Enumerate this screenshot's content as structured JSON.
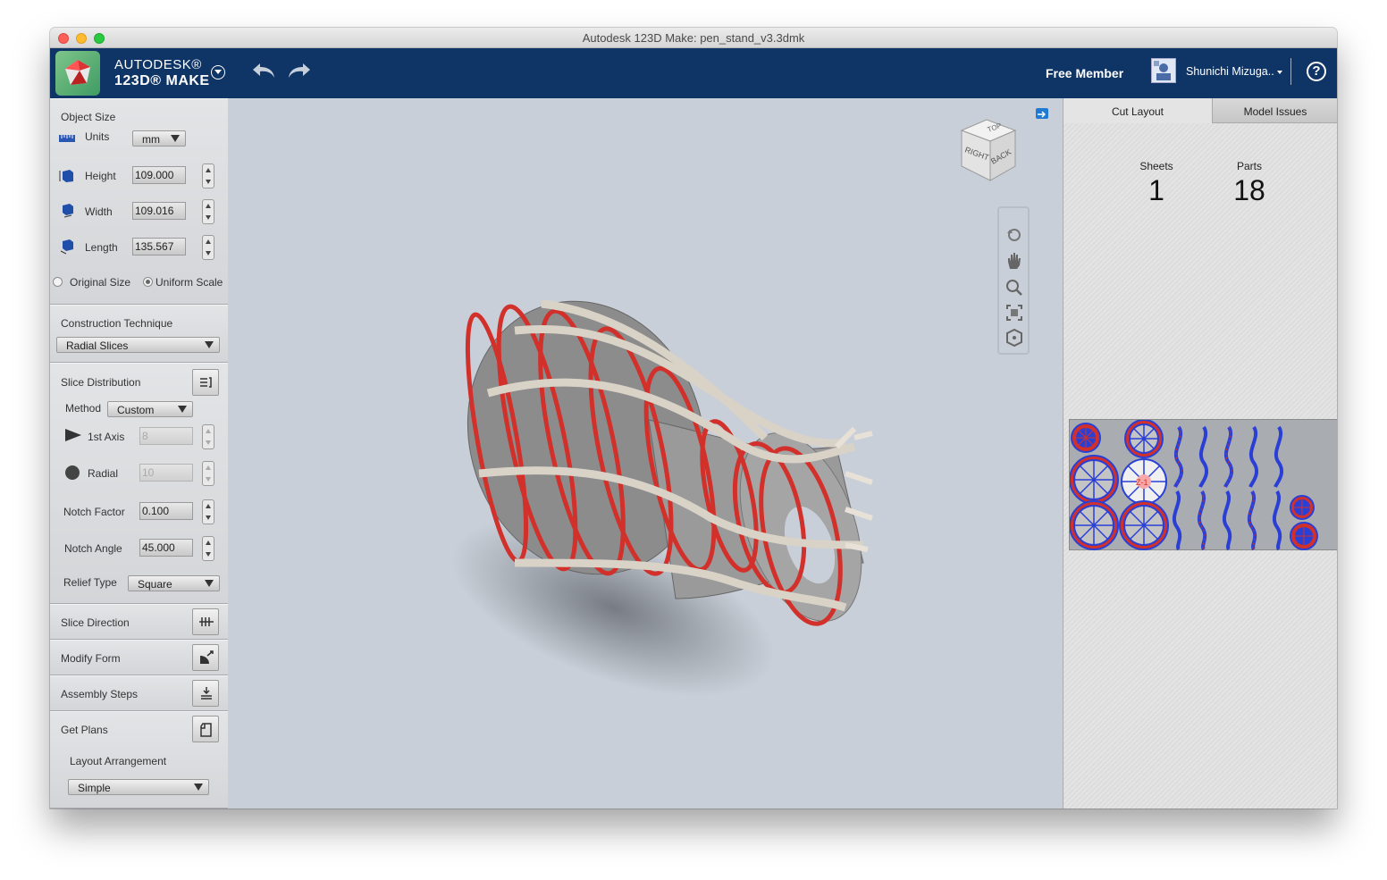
{
  "window": {
    "title": "Autodesk 123D Make: pen_stand_v3.3dmk"
  },
  "brand": {
    "line1": "AUTODESK®",
    "line2": "123D® MAKE"
  },
  "header": {
    "membership": "Free Member",
    "user_name": "Shunichi Mizuga..",
    "help": "?"
  },
  "object_size": {
    "title": "Object Size",
    "units_label": "Units",
    "units_value": "mm",
    "height_label": "Height",
    "height_value": "109.000",
    "width_label": "Width",
    "width_value": "109.016",
    "length_label": "Length",
    "length_value": "135.567",
    "original_size": "Original Size",
    "uniform_scale": "Uniform Scale"
  },
  "construction": {
    "title": "Construction Technique",
    "value": "Radial Slices"
  },
  "slice_distribution": {
    "title": "Slice Distribution",
    "method_label": "Method",
    "method_value": "Custom",
    "axis_label": "1st Axis",
    "axis_value": "8",
    "radial_label": "Radial",
    "radial_value": "10",
    "notch_factor_label": "Notch Factor",
    "notch_factor_value": "0.100",
    "notch_angle_label": "Notch Angle",
    "notch_angle_value": "45.000",
    "relief_label": "Relief Type",
    "relief_value": "Square"
  },
  "sections": {
    "slice_direction": "Slice Direction",
    "modify_form": "Modify Form",
    "assembly_steps": "Assembly Steps",
    "get_plans": "Get Plans"
  },
  "plans": {
    "layout_label": "Layout Arrangement",
    "layout_value": "Simple"
  },
  "viewcube": {
    "top": "TOP",
    "right": "RIGHT",
    "back": "BACK"
  },
  "right_panel": {
    "tabs": [
      "Cut Layout",
      "Model Issues"
    ],
    "sheets_label": "Sheets",
    "sheets_value": "1",
    "parts_label": "Parts",
    "parts_value": "18",
    "part_tag": "Z-1"
  },
  "colors": {
    "header_bg": "#0f3567",
    "slice_red": "#d2302a",
    "layout_blue": "#2a3fd6"
  }
}
